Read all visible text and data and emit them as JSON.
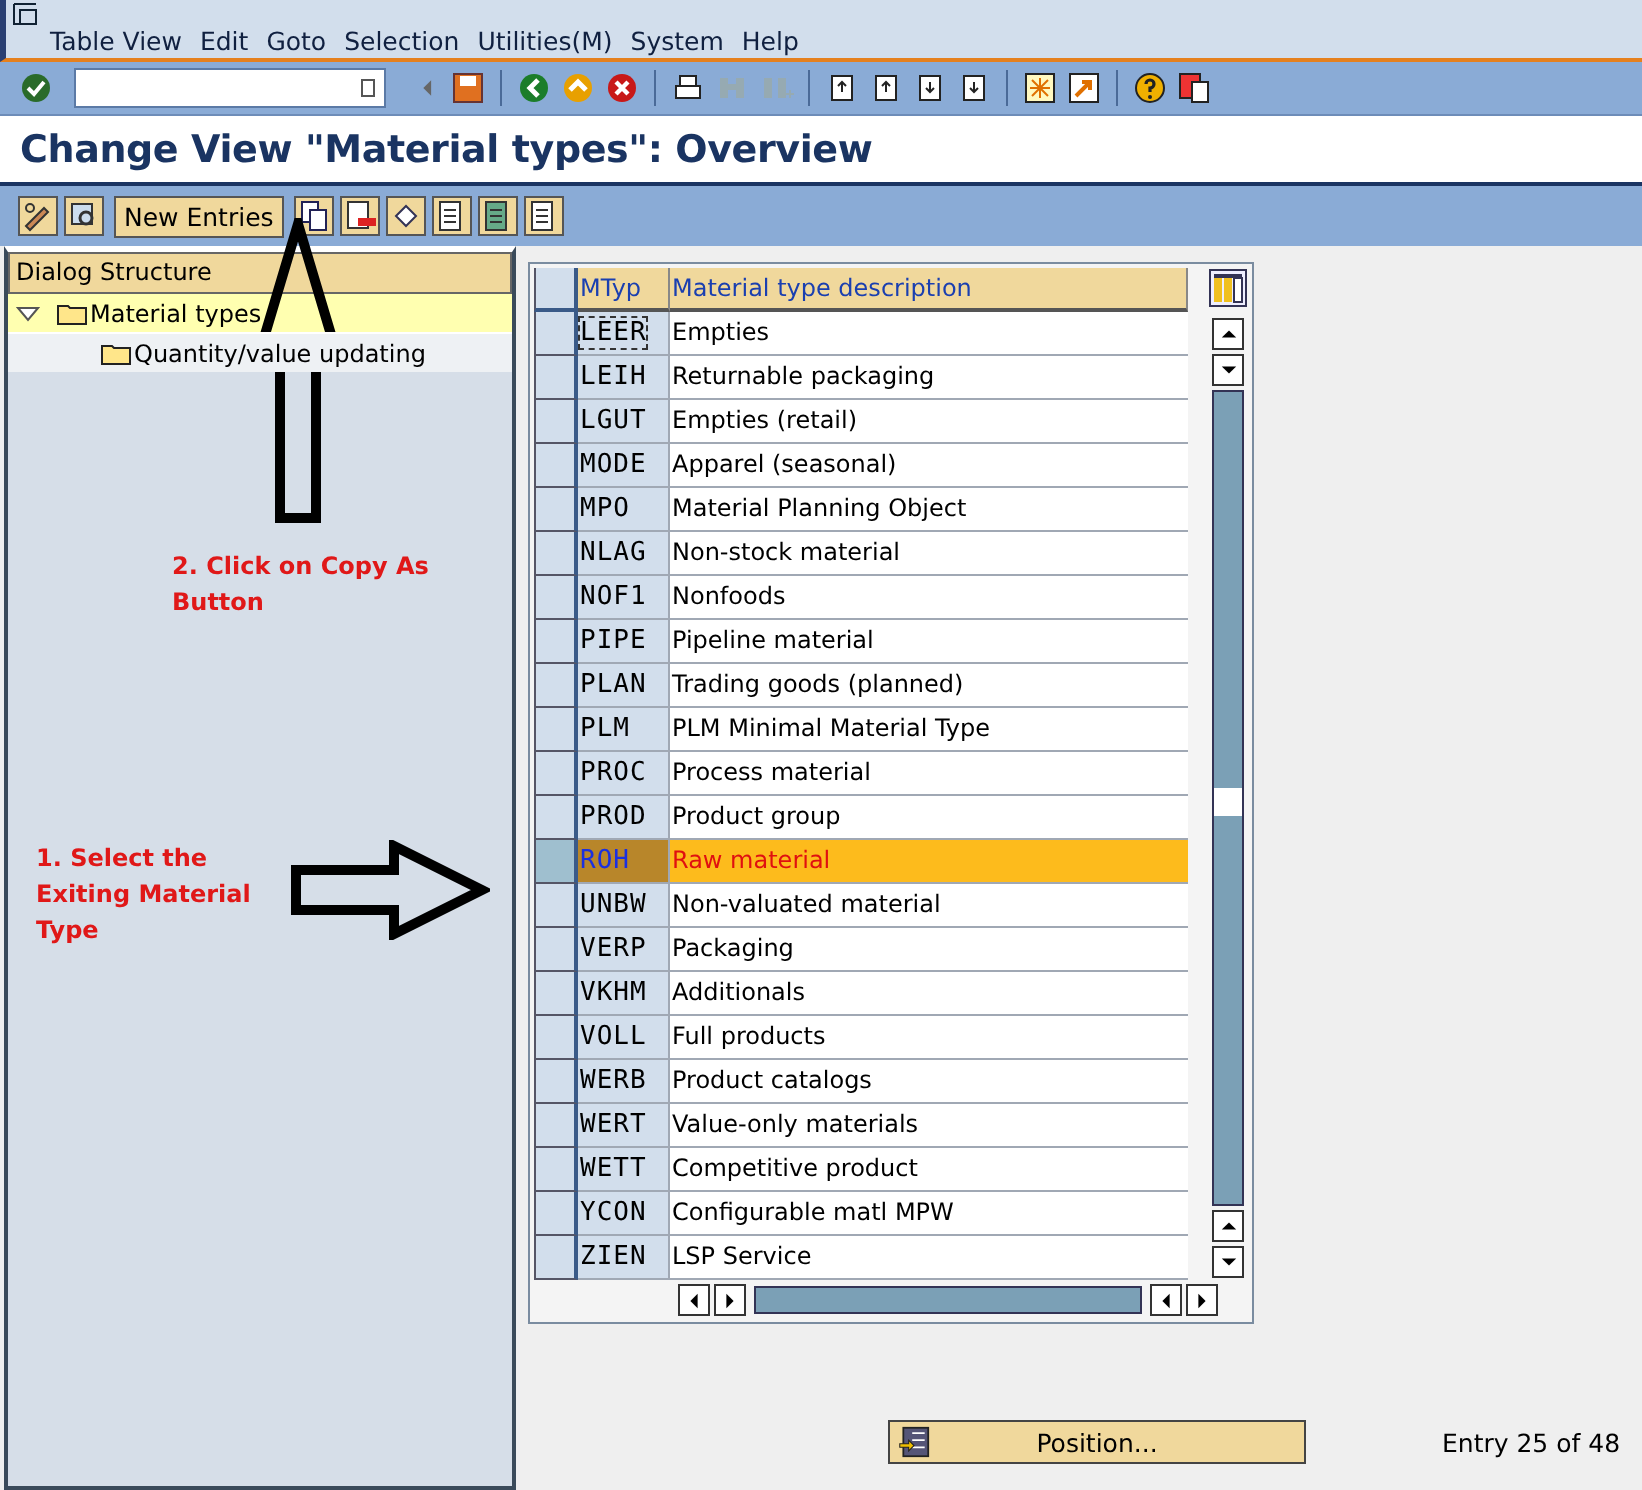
{
  "menu": [
    "Table View",
    "Edit",
    "Goto",
    "Selection",
    "Utilities(M)",
    "System",
    "Help"
  ],
  "title": "Change View \"Material types\": Overview",
  "app_toolbar": {
    "new_entries": "New Entries"
  },
  "dialog_structure": {
    "heading": "Dialog Structure",
    "tree": [
      {
        "label": "Material types",
        "expanded": true,
        "selected": true,
        "children": [
          {
            "label": "Quantity/value updating",
            "selected": false
          }
        ]
      }
    ]
  },
  "table": {
    "columns": [
      "MTyp",
      "Material type description"
    ],
    "rows": [
      {
        "code": "LEER",
        "description": "Empties",
        "selected": false,
        "focused": true
      },
      {
        "code": "LEIH",
        "description": "Returnable packaging",
        "selected": false,
        "focused": false
      },
      {
        "code": "LGUT",
        "description": "Empties (retail)",
        "selected": false,
        "focused": false
      },
      {
        "code": "MODE",
        "description": "Apparel (seasonal)",
        "selected": false,
        "focused": false
      },
      {
        "code": "MPO",
        "description": "Material Planning Object",
        "selected": false,
        "focused": false
      },
      {
        "code": "NLAG",
        "description": "Non-stock material",
        "selected": false,
        "focused": false
      },
      {
        "code": "NOF1",
        "description": "Nonfoods",
        "selected": false,
        "focused": false
      },
      {
        "code": "PIPE",
        "description": "Pipeline material",
        "selected": false,
        "focused": false
      },
      {
        "code": "PLAN",
        "description": "Trading goods (planned)",
        "selected": false,
        "focused": false
      },
      {
        "code": "PLM",
        "description": "PLM Minimal Material Type",
        "selected": false,
        "focused": false
      },
      {
        "code": "PROC",
        "description": "Process material",
        "selected": false,
        "focused": false
      },
      {
        "code": "PROD",
        "description": "Product group",
        "selected": false,
        "focused": false
      },
      {
        "code": "ROH",
        "description": "Raw material",
        "selected": true,
        "focused": false
      },
      {
        "code": "UNBW",
        "description": "Non-valuated material",
        "selected": false,
        "focused": false
      },
      {
        "code": "VERP",
        "description": "Packaging",
        "selected": false,
        "focused": false
      },
      {
        "code": "VKHM",
        "description": "Additionals",
        "selected": false,
        "focused": false
      },
      {
        "code": "VOLL",
        "description": "Full products",
        "selected": false,
        "focused": false
      },
      {
        "code": "WERB",
        "description": "Product catalogs",
        "selected": false,
        "focused": false
      },
      {
        "code": "WERT",
        "description": "Value-only materials",
        "selected": false,
        "focused": false
      },
      {
        "code": "WETT",
        "description": "Competitive product",
        "selected": false,
        "focused": false
      },
      {
        "code": "YCON",
        "description": "Configurable matl MPW",
        "selected": false,
        "focused": false
      },
      {
        "code": "ZIEN",
        "description": "LSP Service",
        "selected": false,
        "focused": false
      }
    ]
  },
  "position_button": "Position...",
  "entry_info": "Entry 25 of 48",
  "annotations": [
    {
      "kind": "up",
      "text": "2. Click on Copy As Button"
    },
    {
      "kind": "right",
      "text": "1. Select the Exiting Material Type"
    }
  ]
}
